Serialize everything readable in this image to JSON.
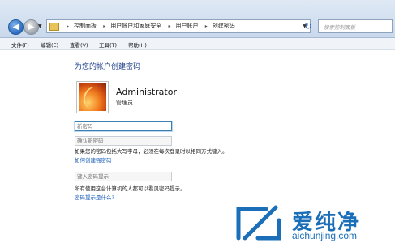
{
  "address_bar": {
    "breadcrumbs": [
      "控制面板",
      "用户帐户和家庭安全",
      "用户帐户",
      "创建密码"
    ],
    "search_placeholder": "搜索控制面板"
  },
  "menu": [
    "文件(F)",
    "编辑(E)",
    "查看(V)",
    "工具(T)",
    "帮助(H)"
  ],
  "page": {
    "title": "为您的帐户创建密码",
    "user_name": "Administrator",
    "user_role": "管理员",
    "new_password_placeholder": "新密码",
    "confirm_password_placeholder": "确认新密码",
    "caps_hint": "如果您的密码包括大写字母，必须在每次登录时以相同方式键入。",
    "strong_password_link": "如何创建强密码",
    "hint_placeholder": "键入密码提示",
    "hint_visibility_text": "所有使用这台计算机的人都可以看见密码提示。",
    "what_is_hint_link": "密码提示是什么?"
  },
  "watermark": {
    "brand_cn": "爱纯净",
    "brand_url": "aichunjing.com",
    "brand_color": "#1a6fb8"
  }
}
